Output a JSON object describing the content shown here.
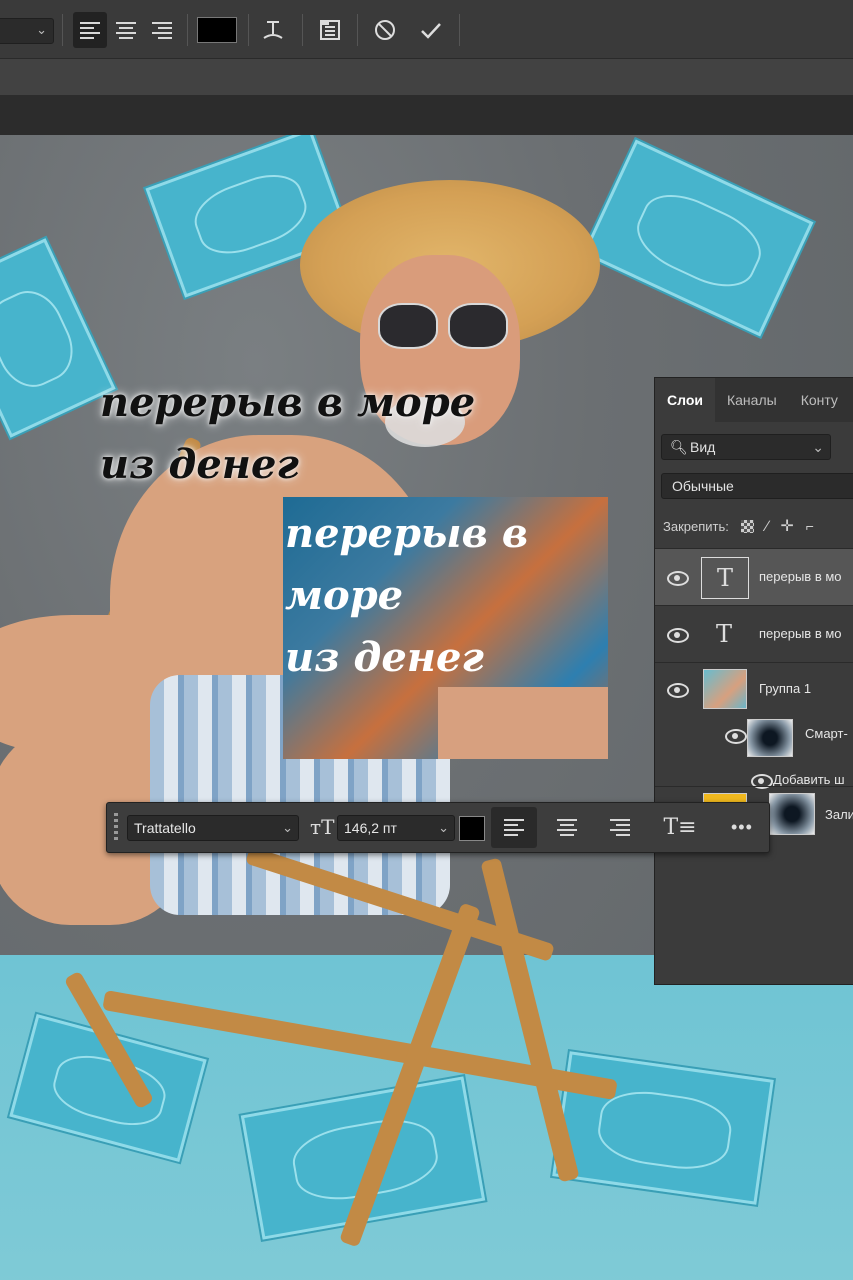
{
  "option_bar": {
    "cancel_icon": "cancel-icon",
    "commit_icon": "checkmark-icon",
    "warp_text_icon": "warp-text-icon",
    "panels_icon": "character-panel-icon",
    "text_color": "#000000"
  },
  "canvas": {
    "caption_line1": "перерыв в море",
    "caption_line2": "из денег",
    "glitch_line1": "перерыв в море",
    "glitch_line2": "из денег"
  },
  "layers_panel": {
    "tabs": [
      "Слои",
      "Каналы",
      "Конту"
    ],
    "search_placeholder": "Вид",
    "blend_mode": "Обычные",
    "lock_label": "Закрепить:",
    "layers": [
      {
        "name": "перерыв в мо",
        "type": "text",
        "selected": true
      },
      {
        "name": "перерыв в мо",
        "type": "text",
        "selected": false
      },
      {
        "name": "Группа 1",
        "type": "group",
        "selected": false
      },
      {
        "name": "Смарт-",
        "type": "smart-filter",
        "selected": false
      },
      {
        "name": "Добавить ш",
        "type": "add-filter",
        "selected": false
      },
      {
        "name": "Зали",
        "type": "fill",
        "selected": false
      }
    ]
  },
  "floating_toolbar": {
    "font_family": "Trattatello",
    "font_size": "146,2 пт",
    "text_color": "#000000",
    "more_label": "•••"
  }
}
